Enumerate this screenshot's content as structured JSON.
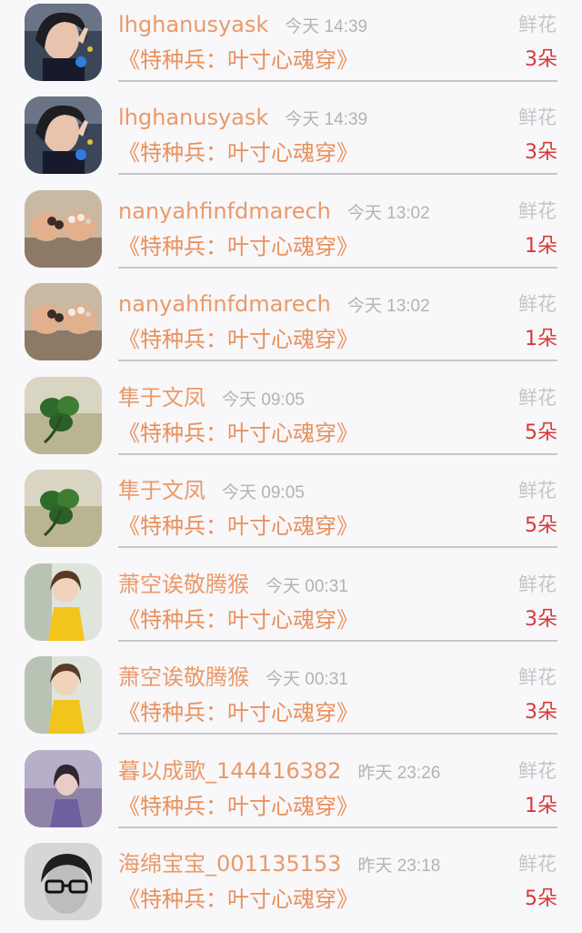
{
  "gift_records": [
    {
      "username": "lhghanusyask",
      "time": "今天 14:39",
      "gift_type": "鲜花",
      "book": "《特种兵：叶寸心魂穿》",
      "count": "3朵",
      "avatar": "girl-peace-sign-avatar"
    },
    {
      "username": "lhghanusyask",
      "time": "今天 14:39",
      "gift_type": "鲜花",
      "book": "《特种兵：叶寸心魂穿》",
      "count": "3朵",
      "avatar": "girl-peace-sign-avatar"
    },
    {
      "username": "nanyahfinfdmarech",
      "time": "今天 13:02",
      "gift_type": "鲜花",
      "book": "《特种兵：叶寸心魂穿》",
      "count": "1朵",
      "avatar": "hands-rings-avatar"
    },
    {
      "username": "nanyahfinfdmarech",
      "time": "今天 13:02",
      "gift_type": "鲜花",
      "book": "《特种兵：叶寸心魂穿》",
      "count": "1朵",
      "avatar": "hands-rings-avatar"
    },
    {
      "username": "隼于文凤",
      "time": "今天 09:05",
      "gift_type": "鲜花",
      "book": "《特种兵：叶寸心魂穿》",
      "count": "5朵",
      "avatar": "clover-avatar"
    },
    {
      "username": "隼于文凤",
      "time": "今天 09:05",
      "gift_type": "鲜花",
      "book": "《特种兵：叶寸心魂穿》",
      "count": "5朵",
      "avatar": "clover-avatar"
    },
    {
      "username": "萧空诶敬腾猴",
      "time": "今天 00:31",
      "gift_type": "鲜花",
      "book": "《特种兵：叶寸心魂穿》",
      "count": "3朵",
      "avatar": "little-girl-yellow-dress-avatar"
    },
    {
      "username": "萧空诶敬腾猴",
      "time": "今天 00:31",
      "gift_type": "鲜花",
      "book": "《特种兵：叶寸心魂穿》",
      "count": "3朵",
      "avatar": "little-girl-yellow-dress-avatar"
    },
    {
      "username": "暮以成歌_144416382",
      "time": "昨天 23:26",
      "gift_type": "鲜花",
      "book": "《特种兵：叶寸心魂穿》",
      "count": "1朵",
      "avatar": "purple-girl-avatar"
    },
    {
      "username": "海绵宝宝_001135153",
      "time": "昨天 23:18",
      "gift_type": "鲜花",
      "book": "《特种兵：叶寸心魂穿》",
      "count": "5朵",
      "avatar": "boy-glasses-avatar"
    }
  ]
}
